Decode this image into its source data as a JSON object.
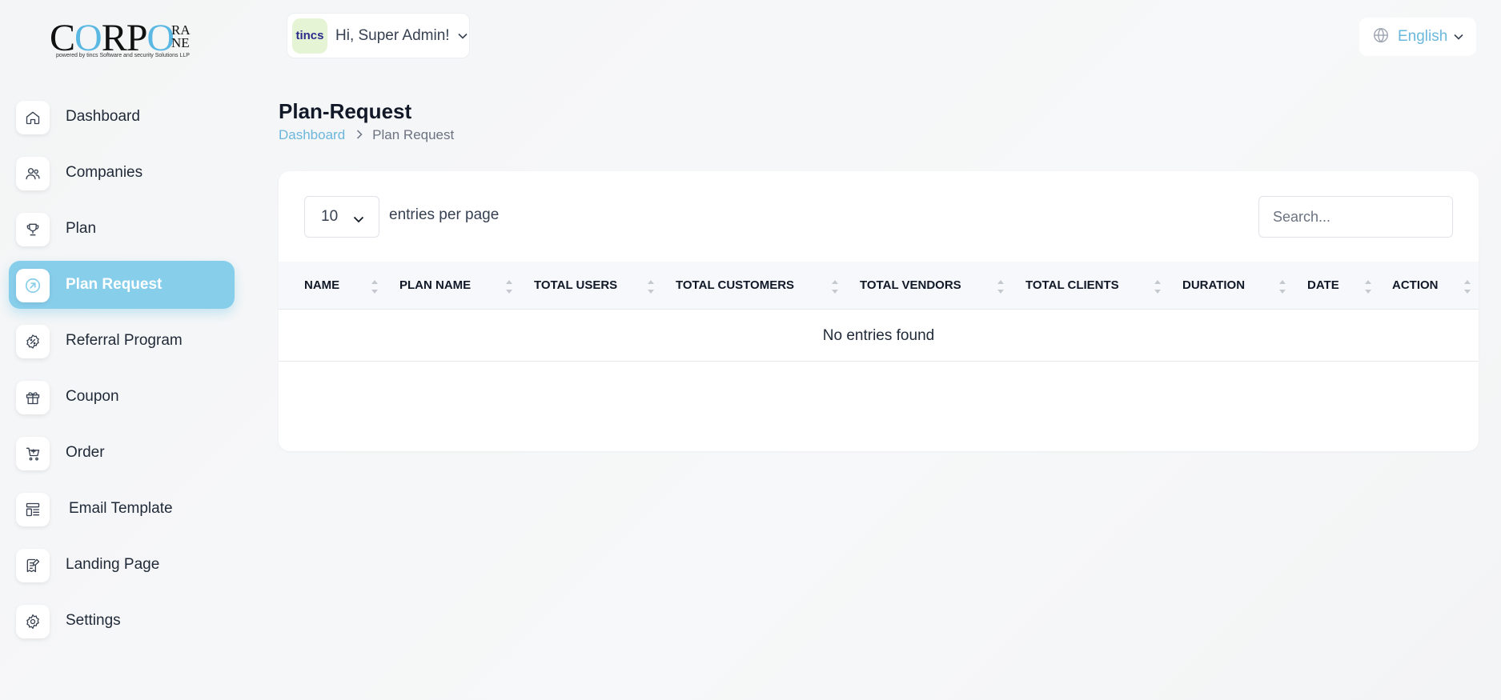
{
  "brand": {
    "logo_main_a": "C",
    "logo_o1": "O",
    "logo_main_b": "RP",
    "logo_o2": "O",
    "logo_side_top": "RA",
    "logo_side_bottom": "NE",
    "tagline": "powered by tincs Software and security Solutions LLP"
  },
  "sidebar": {
    "items": [
      {
        "label": "Dashboard",
        "icon": "home-icon",
        "active": false
      },
      {
        "label": "Companies",
        "icon": "users-icon",
        "active": false
      },
      {
        "label": "Plan",
        "icon": "trophy-icon",
        "active": false
      },
      {
        "label": "Plan Request",
        "icon": "arrow-up-right-circle-icon",
        "active": true
      },
      {
        "label": "Referral Program",
        "icon": "discount-badge-icon",
        "active": false
      },
      {
        "label": "Coupon",
        "icon": "gift-icon",
        "active": false
      },
      {
        "label": "Order",
        "icon": "cart-icon",
        "active": false
      },
      {
        "label": "Email Template",
        "icon": "template-icon",
        "active": false
      },
      {
        "label": "Landing Page",
        "icon": "document-edit-icon",
        "active": false
      },
      {
        "label": "Settings",
        "icon": "gear-icon",
        "active": false
      }
    ]
  },
  "header": {
    "avatar_text": "tincs",
    "user_greeting": "Hi, Super Admin!",
    "language": "English"
  },
  "page": {
    "title": "Plan-Request",
    "breadcrumb": {
      "home": "Dashboard",
      "current": "Plan Request"
    }
  },
  "table": {
    "per_page_value": "10",
    "per_page_label": "entries per page",
    "search_placeholder": "Search...",
    "columns": [
      "NAME",
      "PLAN NAME",
      "TOTAL USERS",
      "TOTAL CUSTOMERS",
      "TOTAL VENDORS",
      "TOTAL CLIENTS",
      "DURATION",
      "DATE",
      "ACTION"
    ],
    "empty_message": "No entries found"
  },
  "colors": {
    "accent": "#87ceeb",
    "link": "#6cb6dc"
  }
}
